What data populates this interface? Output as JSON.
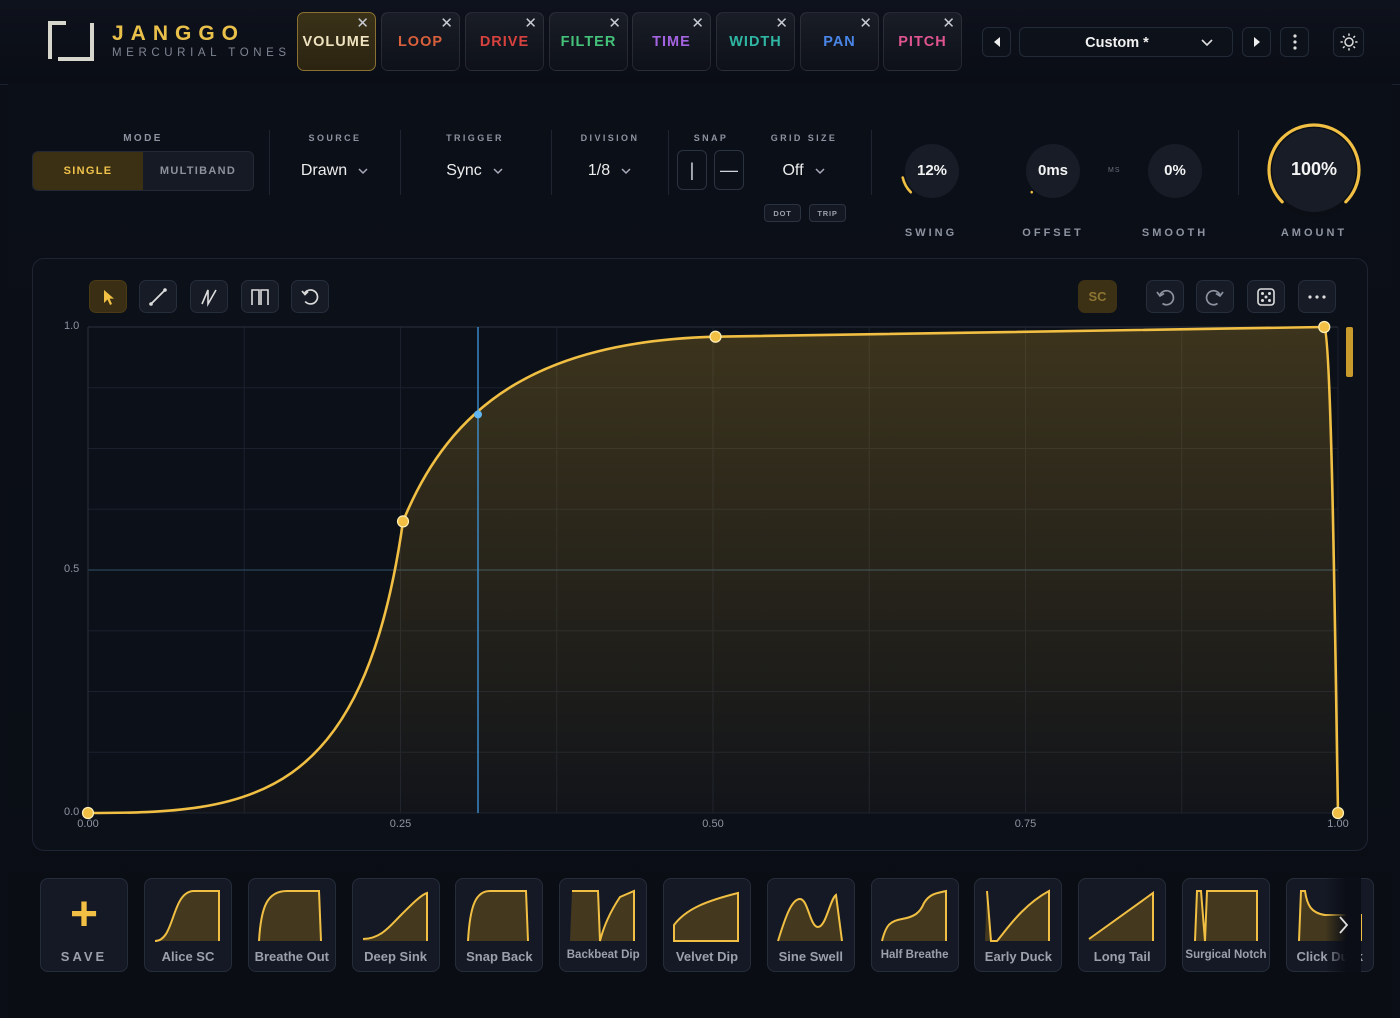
{
  "header": {
    "brand": "JANGGO",
    "subtitle": "MERCURIAL TONES",
    "tabs": [
      {
        "label": "VOLUME",
        "color": "#efe3c0",
        "active": true
      },
      {
        "label": "LOOP",
        "color": "#d9603c"
      },
      {
        "label": "DRIVE",
        "color": "#d8423e"
      },
      {
        "label": "FILTER",
        "color": "#45c27a"
      },
      {
        "label": "TIME",
        "color": "#a463e0"
      },
      {
        "label": "WIDTH",
        "color": "#2fb7a4"
      },
      {
        "label": "PAN",
        "color": "#4a86e8"
      },
      {
        "label": "PITCH",
        "color": "#e0558f"
      }
    ],
    "close_glyph": "✕",
    "preset": {
      "name": "Custom *"
    }
  },
  "controls": {
    "mode": {
      "label": "MODE",
      "options": [
        "SINGLE",
        "MULTIBAND"
      ],
      "selected": "SINGLE"
    },
    "source": {
      "label": "SOURCE",
      "value": "Drawn"
    },
    "trigger": {
      "label": "TRIGGER",
      "value": "Sync"
    },
    "division": {
      "label": "DIVISION",
      "value": "1/8"
    },
    "snap": {
      "label": "SNAP",
      "buttons": [
        "|",
        "—"
      ]
    },
    "grid_size": {
      "label": "GRID SIZE",
      "value": "Off",
      "extra": [
        "DOT",
        "TRIP"
      ]
    },
    "knobs": {
      "swing": {
        "label": "SWING",
        "value": "12%",
        "level": 0.12
      },
      "offset": {
        "label": "OFFSET",
        "value": "0ms",
        "level": 0.0
      },
      "ms_tag": "MS",
      "smooth": {
        "label": "SMOOTH",
        "value": "0%",
        "level": 0.0
      },
      "amount": {
        "label": "AMOUNT",
        "value": "100%",
        "level": 1.0
      }
    }
  },
  "editor": {
    "tools": [
      "pointer-icon",
      "line-icon",
      "ramp-icon",
      "square-wave-icon",
      "reset-icon"
    ],
    "sc_label": "SC",
    "accent": "#f0bf43",
    "cursor_color": "#3d8fd1",
    "y_axis": {
      "ticks": [
        "1.0",
        "0.5",
        "0.0"
      ],
      "values": [
        1.0,
        0.5,
        0.0
      ]
    },
    "x_axis": {
      "ticks": [
        "0.00",
        "0.25",
        "0.50",
        "0.75",
        "1.00"
      ],
      "values": [
        0,
        0.25,
        0.5,
        0.75,
        1.0
      ]
    },
    "points": [
      {
        "x": 0.0,
        "y": 0.0
      },
      {
        "x": 0.252,
        "y": 0.6
      },
      {
        "x": 0.502,
        "y": 0.98
      },
      {
        "x": 0.989,
        "y": 1.0
      },
      {
        "x": 1.0,
        "y": 0.0
      }
    ],
    "cursor": {
      "x": 0.312,
      "y": 0.82
    }
  },
  "presets": {
    "save_label": "SAVE",
    "items": [
      "Alice SC",
      "Breathe Out",
      "Deep Sink",
      "Snap Back",
      "Backbeat Dip",
      "Velvet Dip",
      "Sine Swell",
      "Half Breathe",
      "Early Duck",
      "Long Tail",
      "Surgical Notch",
      "Click Duck"
    ]
  }
}
